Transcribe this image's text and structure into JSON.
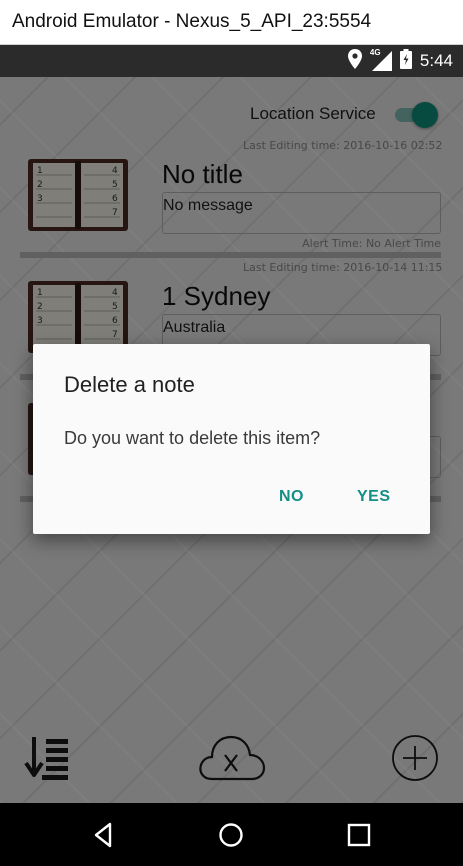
{
  "window": {
    "title": "Android Emulator - Nexus_5_API_23:5554"
  },
  "status_bar": {
    "time": "5:44",
    "icons": [
      "location-icon",
      "signal-4g-icon",
      "battery-icon"
    ],
    "network_label": "4G"
  },
  "header": {
    "location_label": "Location Service",
    "location_enabled": true
  },
  "notes": [
    {
      "edit_time": "Last Editing time: 2016-10-16 02:52",
      "title": "No title",
      "message": "No message",
      "alert": "Alert Time: No Alert Time"
    },
    {
      "edit_time": "Last Editing time: 2016-10-14 11:15",
      "title": "1 Sydney",
      "message": "Australia",
      "alert": ""
    }
  ],
  "bottom_bar": {
    "icons": [
      "sort-icon",
      "cloud-cancel-icon",
      "add-circle-icon"
    ]
  },
  "dialog": {
    "title": "Delete a note",
    "message": "Do you want to delete this item?",
    "no_label": "NO",
    "yes_label": "YES"
  },
  "nav_bar": {
    "icons": [
      "back-icon",
      "home-icon",
      "recents-icon"
    ]
  },
  "colors": {
    "accent": "#138f86",
    "toggle_thumb": "#0f8f7a",
    "status_bar": "#2b2b2b",
    "nav_bar": "#000000"
  }
}
